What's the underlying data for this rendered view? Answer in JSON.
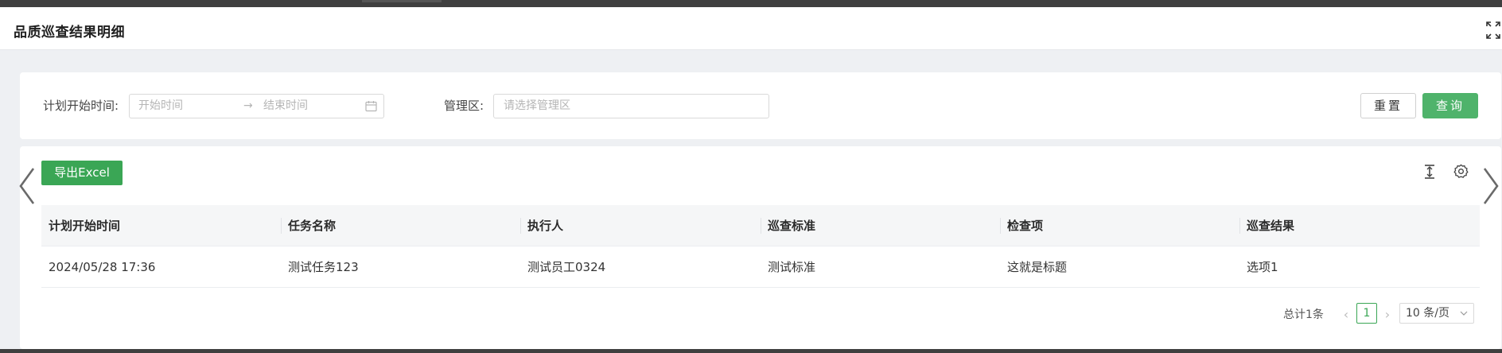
{
  "modal": {
    "title": "品质巡查结果明细"
  },
  "filters": {
    "plan_start_label": "计划开始时间:",
    "start_placeholder": "开始时间",
    "range_separator": "→",
    "end_placeholder": "结束时间",
    "area_label": "管理区:",
    "area_placeholder": "请选择管理区",
    "reset_label": "重置",
    "query_label": "查询"
  },
  "toolbar": {
    "export_label": "导出Excel"
  },
  "table": {
    "columns": [
      "计划开始时间",
      "任务名称",
      "执行人",
      "巡查标准",
      "检查项",
      "巡查结果"
    ],
    "rows": [
      [
        "2024/05/28 17:36",
        "测试任务123",
        "测试员工0324",
        "测试标准",
        "这就是标题",
        "选项1"
      ]
    ]
  },
  "pagination": {
    "total_text": "总计1条",
    "prev": "‹",
    "current_page": "1",
    "next": "›",
    "page_size": "10 条/页"
  },
  "icons": {
    "fullscreen": "fullscreen-icon",
    "calendar": "calendar-icon",
    "density": "column-height-icon",
    "settings": "settings-icon",
    "nav_prev": "chevron-left-icon",
    "nav_next": "chevron-right-icon",
    "page_size_dropdown": "chevron-down-icon"
  },
  "colors": {
    "primary_green": "#4fb36b",
    "export_green": "#3aa655",
    "background": "#eef0f3"
  }
}
